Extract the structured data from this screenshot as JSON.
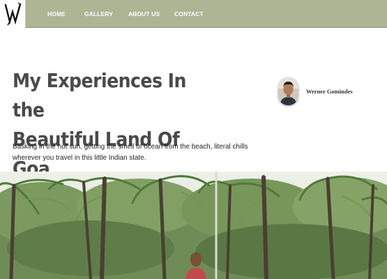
{
  "nav": {
    "logo_alt": "W",
    "links": [
      "HOME",
      "GALLERY",
      "ABOUT US",
      "CONTACT"
    ]
  },
  "hero": {
    "title_line1": "My Experiences In the",
    "title_line2": "Beautiful Land Of Goa",
    "author": "Werner Gomindes",
    "subtitle": "Basking in the hot sun, getting the smell of ocean from the beach, literal chills wherever you travel in this little Indian state."
  },
  "colors": {
    "nav_bg": "#adb594",
    "title": "#4a4a4a",
    "nav_text": "#ffffff"
  },
  "icons": {
    "logo": "w-logo-icon"
  }
}
